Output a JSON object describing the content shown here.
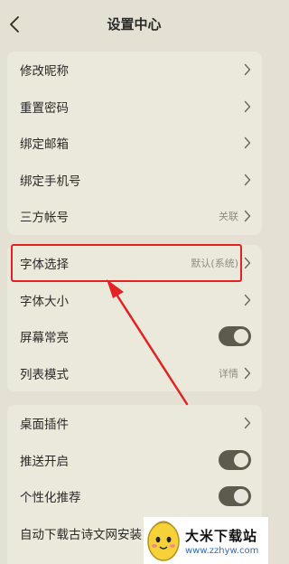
{
  "header": {
    "title": "设置中心",
    "back_icon": "chevron-left-icon"
  },
  "group1": {
    "items": [
      {
        "label": "修改昵称",
        "value": ""
      },
      {
        "label": "重置密码",
        "value": ""
      },
      {
        "label": "绑定邮箱",
        "value": ""
      },
      {
        "label": "绑定手机号",
        "value": ""
      },
      {
        "label": "三方帐号",
        "value": "关联"
      }
    ]
  },
  "group2": {
    "items": [
      {
        "label": "字体选择",
        "value": "默认(系统)"
      },
      {
        "label": "字体大小",
        "value": ""
      },
      {
        "label": "屏幕常亮",
        "toggle": true
      },
      {
        "label": "列表模式",
        "value": "详情"
      }
    ]
  },
  "group3": {
    "items": [
      {
        "label": "桌面插件",
        "value": ""
      },
      {
        "label": "推送开启",
        "toggle": true
      },
      {
        "label": "个性化推荐",
        "toggle": true
      },
      {
        "label": "自动下载古诗文网安装"
      }
    ]
  },
  "annotation": {
    "color": "#e52222"
  },
  "watermark": {
    "title": "大米下载站",
    "url": "www.zzhyw.com"
  },
  "colors": {
    "background": "#e4e0d3",
    "card": "#ebe8dc",
    "toggle_on": "#5c5c4c"
  }
}
